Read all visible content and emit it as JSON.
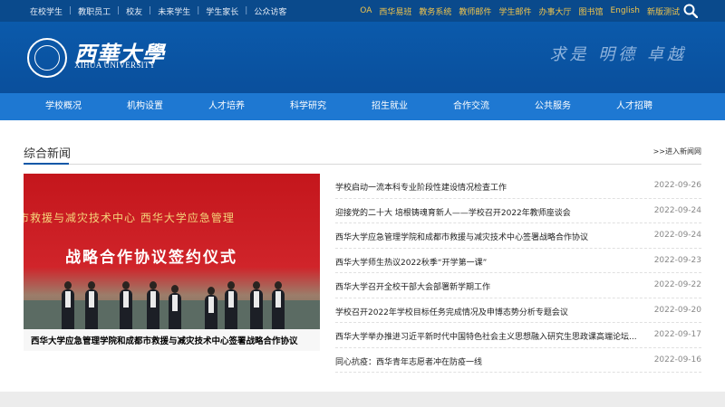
{
  "topbar": {
    "left_links": [
      "在校学生",
      "教职员工",
      "校友",
      "未来学生",
      "学生家长",
      "公众访客"
    ],
    "right_links": [
      "OA",
      "西华易班",
      "教务系统",
      "教师邮件",
      "学生邮件",
      "办事大厅",
      "图书馆",
      "English",
      "新版测试"
    ],
    "accent_color": "#f0c44c"
  },
  "header": {
    "logo_name": "西華大學",
    "logo_en": "XIHUA UNIVERSITY",
    "motto": "求是 明德 卓越",
    "background": "#0b57a8"
  },
  "nav": {
    "items": [
      "学校概况",
      "机构设置",
      "人才培养",
      "科学研究",
      "招生就业",
      "合作交流",
      "公共服务",
      "人才招聘"
    ],
    "background": "#1e78d2"
  },
  "news": {
    "section_title": "综合新闻",
    "more_link": ">>进入新闻网",
    "feature": {
      "photo_banner_line1": "市救援与减灾技术中心 西华大学应急管理",
      "photo_banner_line2": "战略合作协议签约仪式",
      "caption": "西华大学应急管理学院和成都市救援与减灾技术中心签署战略合作协议"
    },
    "items": [
      {
        "title": "学校启动一流本科专业阶段性建设情况检查工作",
        "date": "2022-09-26"
      },
      {
        "title": "迎接党的二十大 培根铸魂育新人——学校召开2022年教师座谈会",
        "date": "2022-09-24"
      },
      {
        "title": "西华大学应急管理学院和成都市救援与减灾技术中心签署战略合作协议",
        "date": "2022-09-24"
      },
      {
        "title": "西华大学师生热议2022秋季“开学第一课”",
        "date": "2022-09-23"
      },
      {
        "title": "西华大学召开全校干部大会部署新学期工作",
        "date": "2022-09-22"
      },
      {
        "title": "学校召开2022年学校目标任务完成情况及申博态势分析专题会议",
        "date": "2022-09-20"
      },
      {
        "title": "西华大学举办推进习近平新时代中国特色社会主义思想融入研究生思政课高端论坛...",
        "date": "2022-09-17"
      },
      {
        "title": "同心抗疫：西华青年志愿者冲在防疫一线",
        "date": "2022-09-16"
      }
    ]
  }
}
